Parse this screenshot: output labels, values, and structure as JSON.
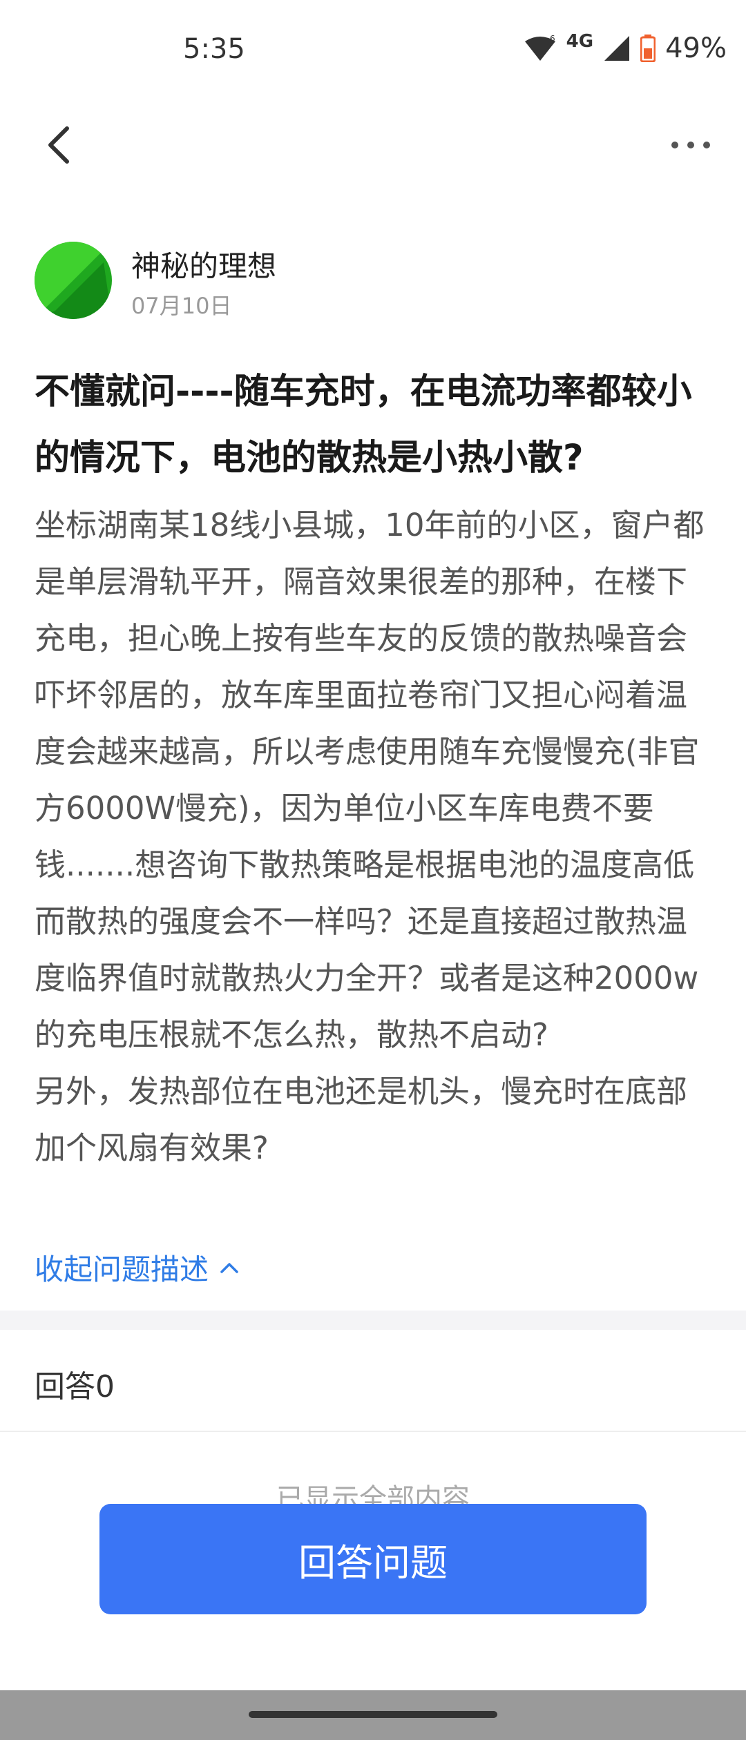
{
  "status_bar": {
    "time": "5:35",
    "network": "4G",
    "battery": "49%"
  },
  "post": {
    "author": "神秘的理想",
    "date": "07月10日",
    "title": "不懂就问----随车充时，在电流功率都较小的情况下，电池的散热是小热小散?",
    "body": [
      "坐标湖南某18线小县城，10年前的小区，窗户都是单层滑轨平开，隔音效果很差的那种，在楼下充电，担心晚上按有些车友的反馈的散热噪音会吓坏邻居的，放车库里面拉卷帘门又担心闷着温度会越来越高，所以考虑使用随车充慢慢充(非官方6000W慢充)，因为单位小区车库电费不要钱.......想咨询下散热策略是根据电池的温度高低而散热的强度会不一样吗？还是直接超过散热温度临界值时就散热火力全开？或者是这种2000w的充电压根就不怎么热，散热不启动?",
      "另外，发热部位在电池还是机头，慢充时在底部加个风扇有效果?"
    ],
    "collapse_label": "收起问题描述"
  },
  "answers": {
    "header": "回答0",
    "all_shown": "已显示全部内容"
  },
  "actions": {
    "answer_button": "回答问题"
  },
  "colors": {
    "accent": "#2f7ce6",
    "button": "#3a75f5",
    "avatar_green": "#22b322",
    "battery_orange": "#f0612e"
  }
}
